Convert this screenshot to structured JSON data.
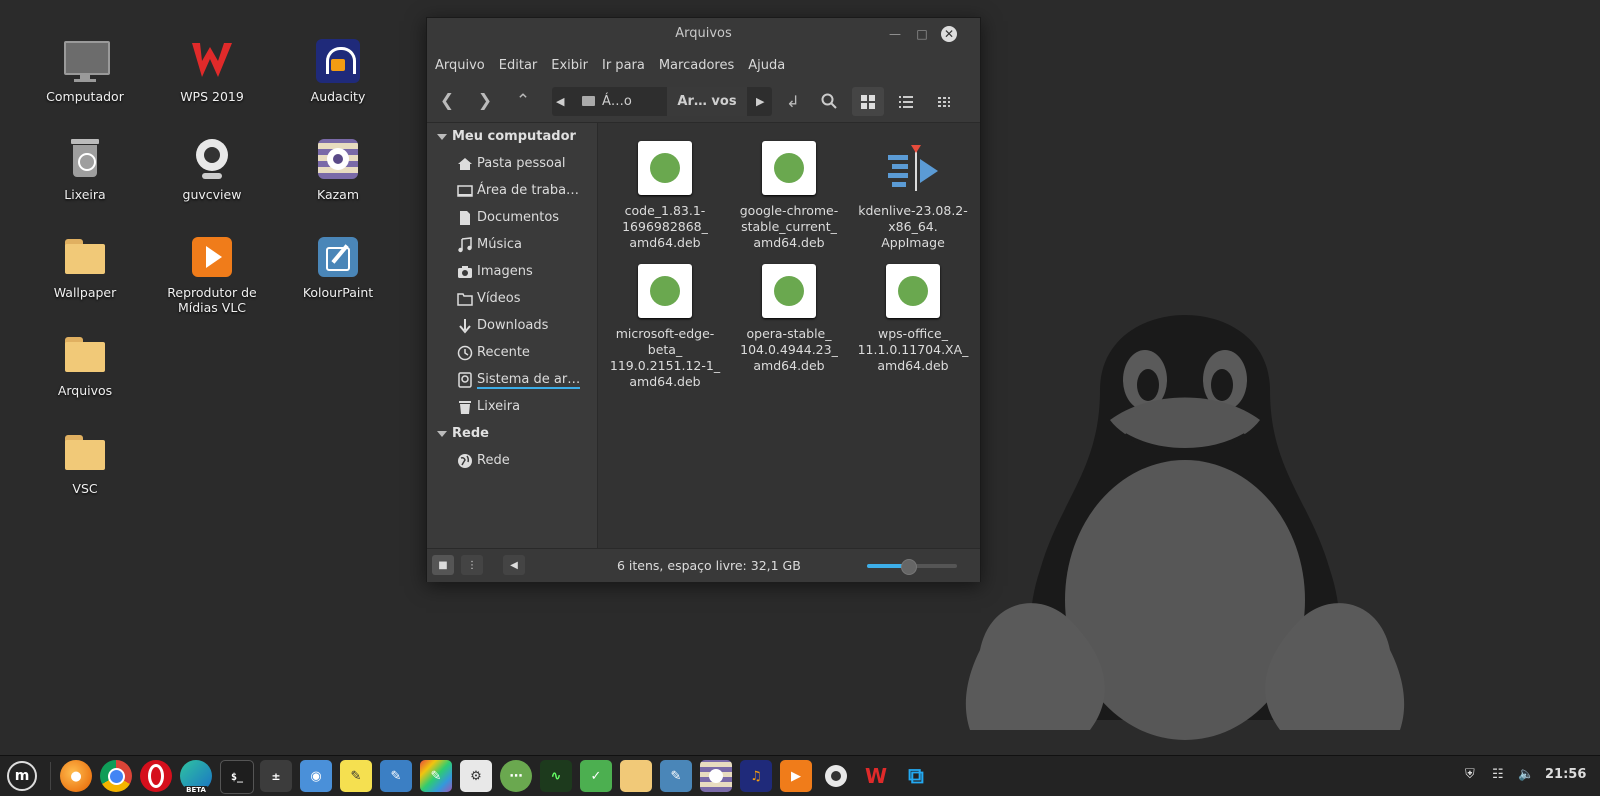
{
  "desktop": {
    "icons": [
      {
        "label": "Computador"
      },
      {
        "label": "WPS 2019"
      },
      {
        "label": "Audacity"
      },
      {
        "label": "Lixeira"
      },
      {
        "label": "guvcview"
      },
      {
        "label": "Kazam"
      },
      {
        "label": "Wallpaper"
      },
      {
        "label": "Reprodutor de Mídias VLC"
      },
      {
        "label": "KolourPaint"
      },
      {
        "label": "Arquivos"
      },
      {
        "label": "VSC"
      }
    ]
  },
  "window": {
    "title": "Arquivos",
    "menu": [
      "Arquivo",
      "Editar",
      "Exibir",
      "Ir para",
      "Marcadores",
      "Ajuda"
    ],
    "breadcrumbs": [
      "Á…o",
      "Ar… vos"
    ],
    "sidebar": {
      "sections": [
        {
          "title": "Meu computador",
          "items": [
            "Pasta pessoal",
            "Área de traba…",
            "Documentos",
            "Música",
            "Imagens",
            "Vídeos",
            "Downloads",
            "Recente",
            "Sistema de ar…",
            "Lixeira"
          ]
        },
        {
          "title": "Rede",
          "items": [
            "Rede"
          ]
        }
      ]
    },
    "files": [
      {
        "name": "code_1.83.1-1696982868_amd64.deb",
        "lines": [
          "code_1.83.1-",
          "1696982868_",
          "amd64.deb"
        ],
        "icon": "package-icon"
      },
      {
        "name": "google-chrome-stable_current_amd64.deb",
        "lines": [
          "google-chrome-",
          "stable_current_",
          "amd64.deb"
        ],
        "icon": "package-icon"
      },
      {
        "name": "kdenlive-23.08.2-x86_64.AppImage",
        "lines": [
          "kdenlive-23.08.2-",
          "x86_64.",
          "AppImage"
        ],
        "icon": "kdenlive-icon"
      },
      {
        "name": "microsoft-edge-beta_119.0.2151.12-1_amd64.deb",
        "lines": [
          "microsoft-edge-",
          "beta_",
          "119.0.2151.12-1_",
          "amd64.deb"
        ],
        "icon": "package-icon"
      },
      {
        "name": "opera-stable_104.0.4944.23_amd64.deb",
        "lines": [
          "opera-stable_",
          "104.0.4944.23_",
          "amd64.deb"
        ],
        "icon": "package-icon"
      },
      {
        "name": "wps-office_11.1.0.11704.XA_amd64.deb",
        "lines": [
          "wps-office_",
          "11.1.0.11704.XA_",
          "amd64.deb"
        ],
        "icon": "package-icon"
      }
    ],
    "status": "6 itens, espaço livre: 32,1 GB",
    "zoom_fraction": 0.45
  },
  "panel": {
    "apps": [
      "menu-icon",
      "firefox-icon",
      "chrome-icon",
      "opera-icon",
      "edge-beta-icon",
      "terminal-icon",
      "calculator-icon",
      "screenshot-icon",
      "sticky-notes-icon",
      "text-editor-icon",
      "drawing-icon",
      "settings-icon",
      "software-manager-icon",
      "system-monitor-icon",
      "update-manager-icon",
      "files-icon",
      "kolourpaint-icon",
      "kazam-icon",
      "audacity-icon",
      "vlc-icon",
      "guvcview-icon",
      "wps-icon",
      "vscode-icon"
    ],
    "edge_badge": "BETA",
    "clock": "21:56"
  },
  "colors": {
    "accent": "#3daee9",
    "desktop_bg": "#2b2b2b",
    "package_green": "#6aa84f"
  }
}
